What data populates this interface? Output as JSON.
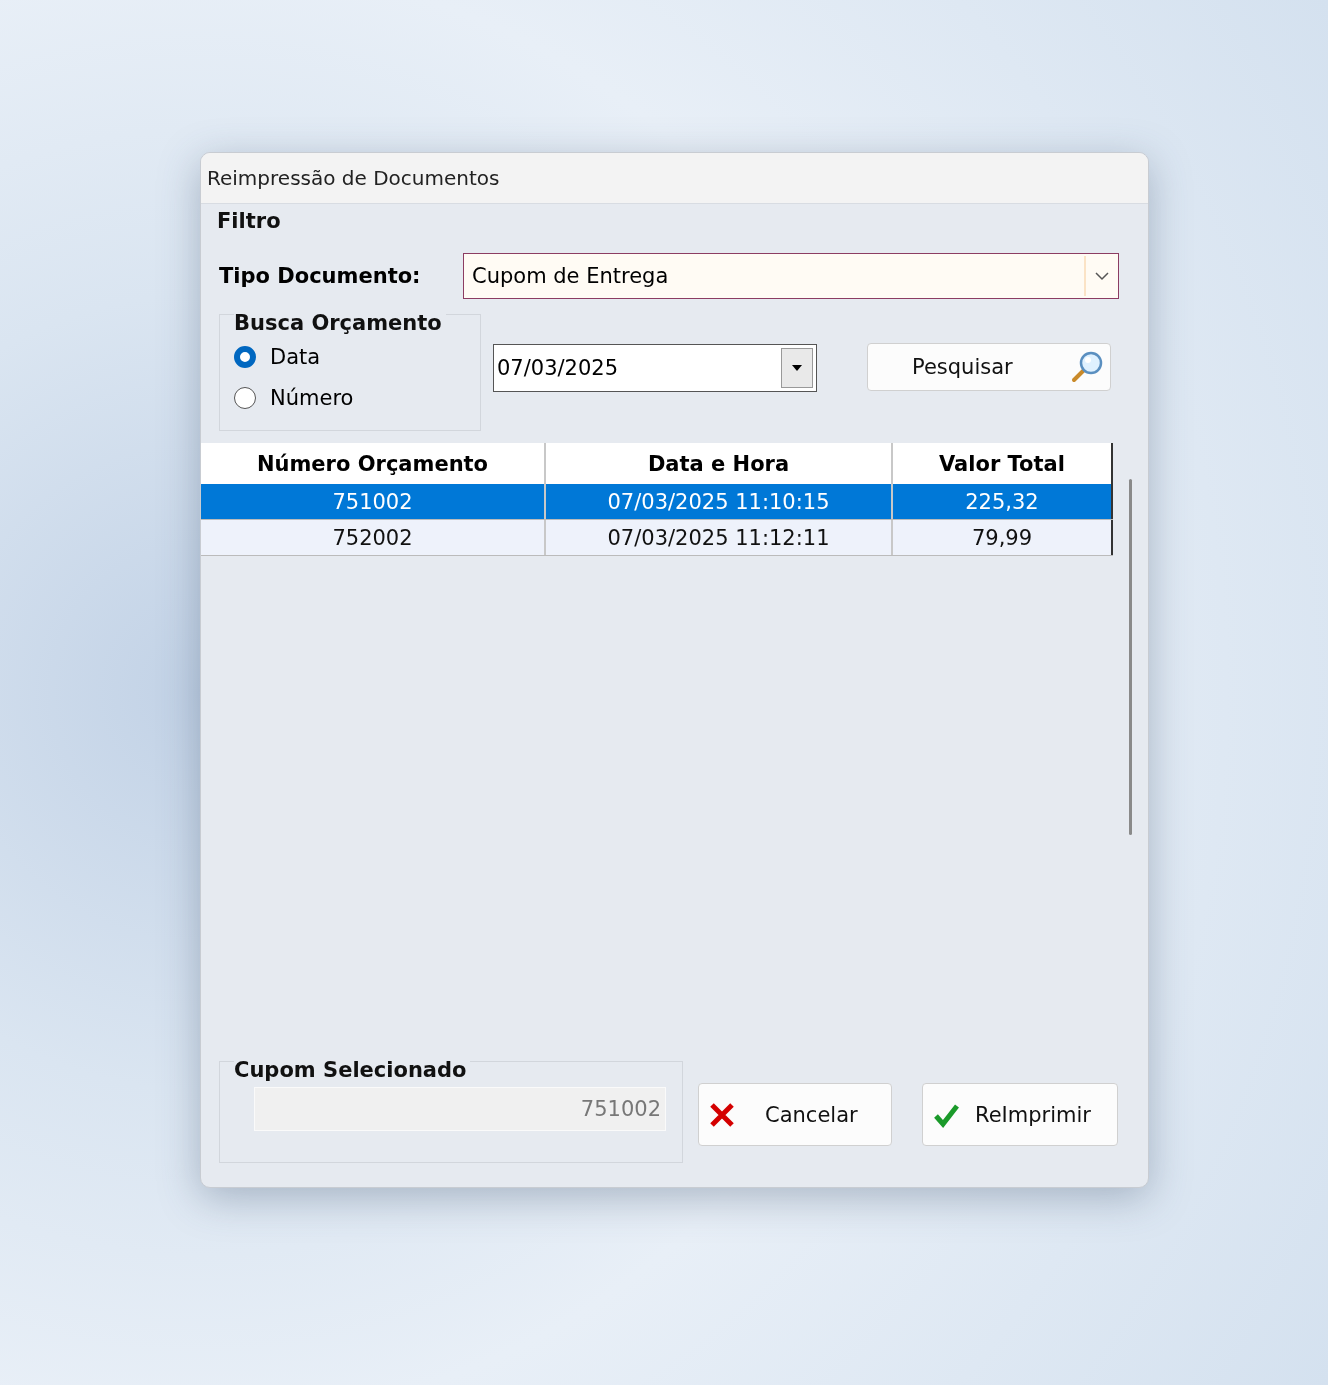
{
  "window": {
    "title": "Reimpressão de Documentos"
  },
  "filter": {
    "title": "Filtro",
    "document_type": {
      "label": "Tipo Documento:",
      "value": "Cupom de Entrega"
    },
    "search_group": {
      "title": "Busca Orçamento",
      "options": [
        {
          "label": "Data",
          "selected": true
        },
        {
          "label": "Número",
          "selected": false
        }
      ]
    },
    "date": {
      "value": "07/03/2025"
    },
    "search_button": "Pesquisar"
  },
  "table": {
    "columns": [
      "Número Orçamento",
      "Data e Hora",
      "Valor Total"
    ],
    "rows": [
      {
        "cells": [
          "751002",
          "07/03/2025 11:10:15",
          "225,32"
        ],
        "selected": true
      },
      {
        "cells": [
          "752002",
          "07/03/2025 11:12:11",
          "79,99"
        ],
        "selected": false
      }
    ]
  },
  "selected_coupon": {
    "title": "Cupom Selecionado",
    "value": "751002"
  },
  "buttons": [
    {
      "label": "Cancelar",
      "kind": "cancel"
    },
    {
      "label": "ReImprimir",
      "kind": "print"
    }
  ]
}
